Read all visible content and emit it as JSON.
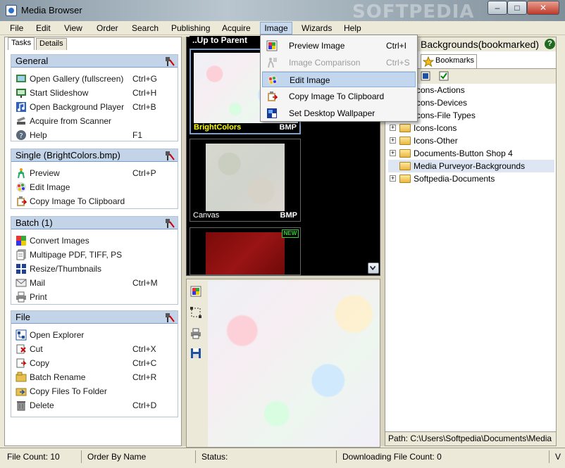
{
  "window": {
    "title": "Media Browser",
    "watermark": "SOFTPEDIA",
    "buttons": {
      "minimize": "–",
      "maximize": "□",
      "close": "✕"
    }
  },
  "menubar": {
    "items": [
      "File",
      "Edit",
      "View",
      "Order",
      "Search",
      "Publishing",
      "Acquire",
      "Image",
      "Wizards",
      "Help"
    ]
  },
  "left_panel": {
    "tabs": [
      "Tasks",
      "Details"
    ],
    "groups": [
      {
        "title": "General",
        "items": [
          {
            "label": "Open Gallery (fullscreen)",
            "shortcut": "Ctrl+G",
            "icon": "gallery-icon"
          },
          {
            "label": "Start Slideshow",
            "shortcut": "Ctrl+H",
            "icon": "slideshow-icon"
          },
          {
            "label": "Open Background Player",
            "shortcut": "Ctrl+B",
            "icon": "music-note-icon"
          },
          {
            "label": "Acquire from Scanner",
            "shortcut": "",
            "icon": "scanner-icon"
          },
          {
            "label": "Help",
            "shortcut": "F1",
            "icon": "help-icon"
          }
        ]
      },
      {
        "title": "Single (BrightColors.bmp)",
        "items": [
          {
            "label": "Preview",
            "shortcut": "Ctrl+P",
            "icon": "preview-icon"
          },
          {
            "label": "Edit Image",
            "shortcut": "",
            "icon": "edit-image-icon"
          },
          {
            "label": "Copy Image To Clipboard",
            "shortcut": "",
            "icon": "clipboard-icon"
          }
        ]
      },
      {
        "title": "Batch (1)",
        "items": [
          {
            "label": "Convert Images",
            "shortcut": "",
            "icon": "convert-icon"
          },
          {
            "label": "Multipage PDF, TIFF, PS",
            "shortcut": "",
            "icon": "pdf-icon"
          },
          {
            "label": "Resize/Thumbnails",
            "shortcut": "",
            "icon": "thumbnails-icon"
          },
          {
            "label": "Mail",
            "shortcut": "Ctrl+M",
            "icon": "mail-icon"
          },
          {
            "label": "Print",
            "shortcut": "",
            "icon": "printer-icon"
          }
        ]
      },
      {
        "title": "File",
        "items": [
          {
            "label": "Open Explorer",
            "shortcut": "",
            "icon": "explorer-icon"
          },
          {
            "label": "Cut",
            "shortcut": "Ctrl+X",
            "icon": "cut-icon"
          },
          {
            "label": "Copy",
            "shortcut": "Ctrl+C",
            "icon": "copy-icon"
          },
          {
            "label": "Batch Rename",
            "shortcut": "Ctrl+R",
            "icon": "rename-icon"
          },
          {
            "label": "Copy Files To Folder",
            "shortcut": "",
            "icon": "copy-folder-icon"
          },
          {
            "label": "Delete",
            "shortcut": "Ctrl+D",
            "icon": "delete-icon"
          }
        ]
      }
    ]
  },
  "thumbnails": {
    "up_label": "..Up to Parent",
    "items": [
      {
        "name": "BrightColors",
        "ext": "BMP",
        "badge": ""
      },
      {
        "name": "Canvas",
        "ext": "BMP",
        "badge": ""
      },
      {
        "name": "",
        "ext": "",
        "badge": "NEW"
      }
    ]
  },
  "right_panel": {
    "title": "Backgrounds(bookmarked)",
    "help": "?",
    "tab": "Bookmarks",
    "tree": [
      {
        "label": "cons-Actions",
        "expander": false,
        "selected": false
      },
      {
        "label": "cons-Devices",
        "expander": false,
        "selected": false
      },
      {
        "label": "cons-File Types",
        "expander": false,
        "selected": false
      },
      {
        "label": "Icons-Icons",
        "expander": true,
        "selected": false
      },
      {
        "label": "Icons-Other",
        "expander": true,
        "selected": false
      },
      {
        "label": "Documents-Button Shop 4",
        "expander": true,
        "selected": false
      },
      {
        "label": "Media Purveyor-Backgrounds",
        "expander": false,
        "selected": true
      },
      {
        "label": "Softpedia-Documents",
        "expander": true,
        "selected": false
      }
    ],
    "path": "Path: C:\\Users\\Softpedia\\Documents\\Media"
  },
  "image_menu": {
    "items": [
      {
        "label": "Preview Image",
        "shortcut": "Ctrl+I",
        "disabled": false,
        "highlight": false,
        "icon": "preview-image-icon"
      },
      {
        "label": "Image Comparison",
        "shortcut": "Ctrl+S",
        "disabled": true,
        "highlight": false,
        "icon": "comparison-icon"
      },
      {
        "label": "Edit Image",
        "shortcut": "",
        "disabled": false,
        "highlight": true,
        "icon": "edit-image-icon"
      },
      {
        "label": "Copy Image To Clipboard",
        "shortcut": "",
        "disabled": false,
        "highlight": false,
        "icon": "clipboard-icon"
      },
      {
        "label": "Set Desktop Wallpaper",
        "shortcut": "",
        "disabled": false,
        "highlight": false,
        "icon": "wallpaper-icon"
      }
    ]
  },
  "statusbar": {
    "file_count": "File Count: 10",
    "order": "Order By Name",
    "status": "Status:",
    "downloading": "Downloading File Count: 0",
    "extra": "V"
  },
  "colors": {
    "group_header": "#c4d4e8",
    "selection": "#dde6f2",
    "menu_highlight": "#c2d6ee"
  }
}
